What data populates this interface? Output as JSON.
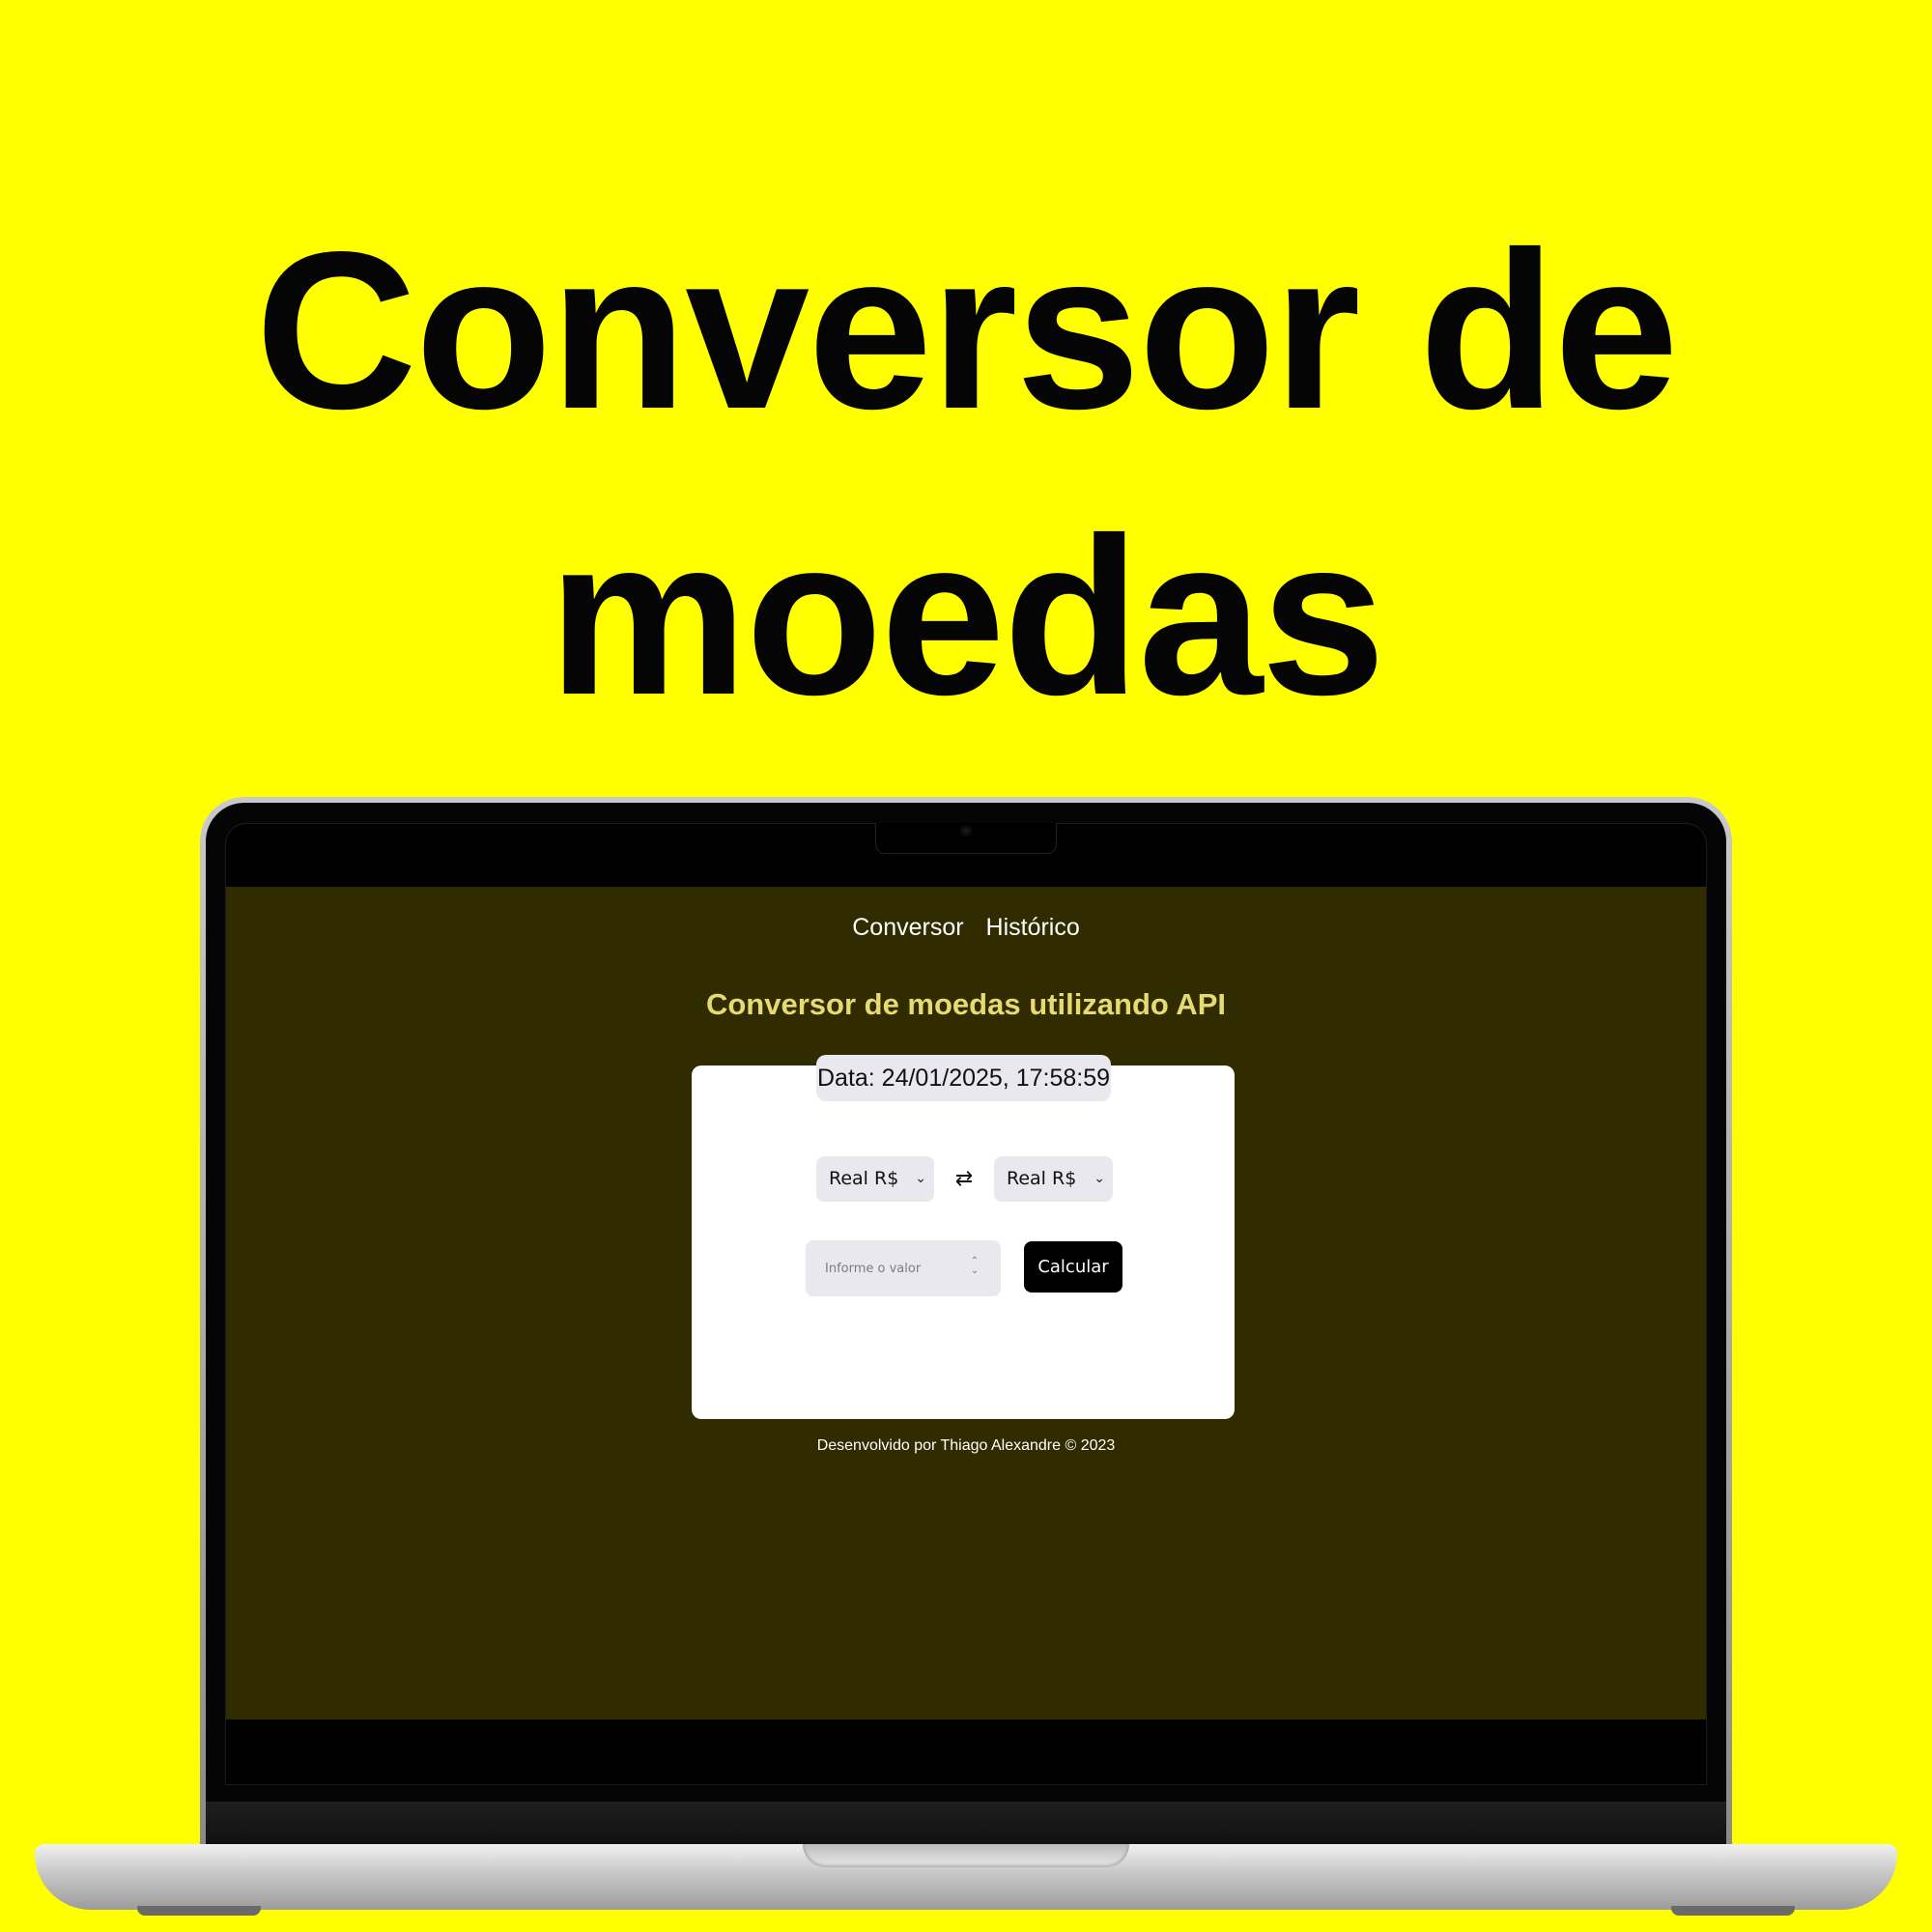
{
  "hero": {
    "line1": "Conversor de",
    "line2": "moedas"
  },
  "app": {
    "nav": {
      "items": [
        {
          "label": "Conversor"
        },
        {
          "label": "Histórico"
        }
      ]
    },
    "heading": "Conversor de moedas utilizando API",
    "date_label": "Data: 24/01/2025, 17:58:59",
    "from_currency": "Real R$",
    "to_currency": "Real R$",
    "amount_input": {
      "placeholder": "Informe o valor",
      "value": ""
    },
    "calculate_label": "Calcular",
    "footer": "Desenvolvido por Thiago Alexandre © 2023"
  },
  "icons": {
    "swap": "swap-arrows-icon",
    "select_chevron": "chevron-down-icon",
    "number_stepper": "up-down-stepper-icon",
    "camera": "camera-icon"
  },
  "colors": {
    "background": "#FFFF00",
    "app_background": "#302C00",
    "heading": "#E6DA70",
    "card": "#FFFFFF",
    "control": "#E9E8EE",
    "button": "#000000"
  }
}
